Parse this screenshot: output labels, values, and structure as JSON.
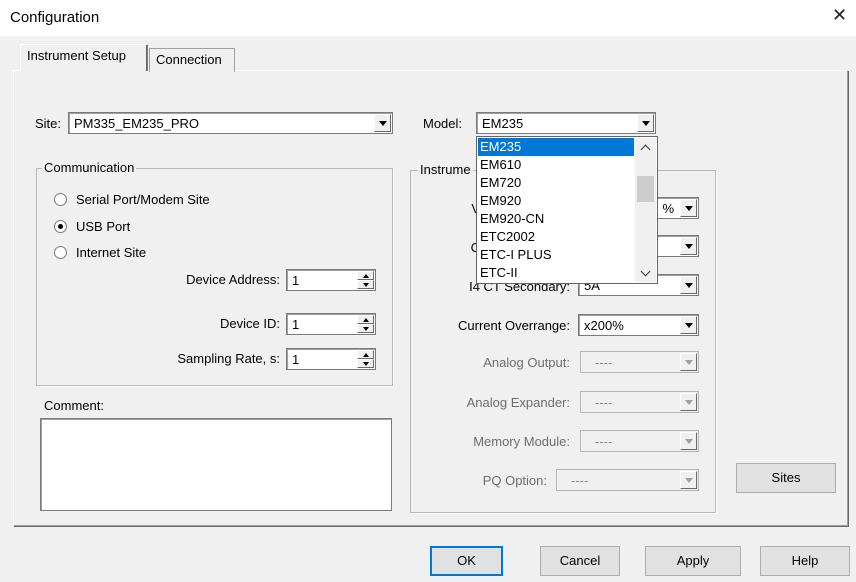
{
  "window": {
    "title": "Configuration",
    "close_glyph": "✕"
  },
  "tabs": [
    {
      "label": "Instrument Setup",
      "active": true
    },
    {
      "label": "Connection",
      "active": false
    }
  ],
  "site": {
    "label": "Site:",
    "value": "PM335_EM235_PRO"
  },
  "model": {
    "label": "Model:",
    "value": "EM235",
    "dropdown_open": true,
    "options": [
      "EM235",
      "EM610",
      "EM720",
      "EM920",
      "EM920-CN",
      "ETC2002",
      "ETC-I PLUS",
      "ETC-II"
    ],
    "selected_index": 0
  },
  "communication": {
    "legend": "Communication",
    "options": [
      {
        "label": "Serial Port/Modem Site",
        "checked": false
      },
      {
        "label": "USB Port",
        "checked": true
      },
      {
        "label": "Internet Site",
        "checked": false
      }
    ],
    "device_address": {
      "label": "Device Address:",
      "value": "1"
    },
    "device_id": {
      "label": "Device ID:",
      "value": "1"
    },
    "sampling_rate": {
      "label": "Sampling Rate, s:",
      "value": "1"
    }
  },
  "comment": {
    "label": "Comment:",
    "value": ""
  },
  "instrument": {
    "legend": "Instrume",
    "row1_label": "V",
    "row1_value": "%",
    "row2_label": "C",
    "row2_value": "",
    "i4_ct": {
      "label": "I4 CT Secondary:",
      "value": "5A"
    },
    "current_overrange": {
      "label": "Current Overrange:",
      "value": "x200%"
    },
    "analog_output": {
      "label": "Analog Output:",
      "value": "----"
    },
    "analog_expander": {
      "label": "Analog Expander:",
      "value": "----"
    },
    "memory_module": {
      "label": "Memory Module:",
      "value": "----"
    },
    "pq_option": {
      "label": "PQ Option:",
      "value": "----"
    }
  },
  "buttons": {
    "sites": "Sites",
    "ok": "OK",
    "cancel": "Cancel",
    "apply": "Apply",
    "help": "Help"
  },
  "icons": [
    "close-icon",
    "dropdown-arrow-icon",
    "spin-up-icon",
    "spin-down-icon",
    "scroll-up-icon",
    "scroll-down-icon"
  ],
  "colors": {
    "selection": "#0078d7",
    "default_button_border": "#0078d7",
    "background": "#f0f0f0"
  }
}
